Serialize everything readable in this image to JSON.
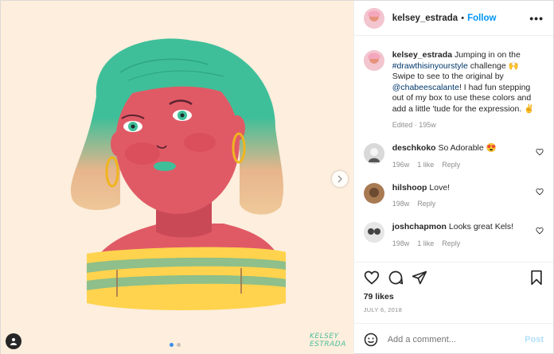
{
  "header": {
    "username": "kelsey_estrada",
    "separator": "•",
    "follow_label": "Follow",
    "more_label": "•••"
  },
  "caption": {
    "username": "kelsey_estrada",
    "text_1": " Jumping in on the ",
    "hashtag": "#drawthisinyourstyle",
    "text_2": " challenge 🙌 Swipe to see to the original by ",
    "mention": "@chabeescalante",
    "text_3": "! I had fun stepping out of my box to use these colors and add a little 'tude for the expression. ✌️",
    "meta": "Edited · 195w"
  },
  "comments": [
    {
      "username": "deschkoko",
      "text": " So Adorable 😍",
      "time": "196w",
      "likes": "1 like",
      "reply": "Reply"
    },
    {
      "username": "hilshoop",
      "text": " Love!",
      "time": "198w",
      "likes": "",
      "reply": "Reply"
    },
    {
      "username": "joshchapmon",
      "text": " Looks great Kels!",
      "time": "198w",
      "likes": "1 like",
      "reply": "Reply"
    }
  ],
  "likes_label": "79 likes",
  "date_label": "JULY 6, 2018",
  "add_comment": {
    "placeholder": "Add a comment...",
    "post_label": "Post"
  },
  "watermark": {
    "line1": "KELSEY",
    "line2": "ESTRADA"
  },
  "carousel": {
    "slides": 2,
    "active": 1
  },
  "colors": {
    "accent": "#0095f6",
    "background": "#fdeedd",
    "skin": "#e05a66",
    "hair": "#3fbf99"
  }
}
